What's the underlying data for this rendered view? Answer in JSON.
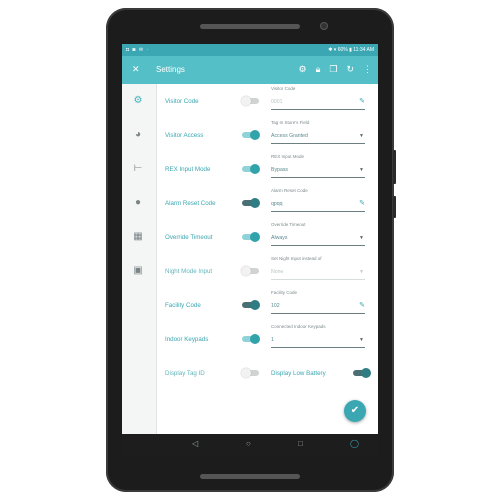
{
  "status_bar": {
    "left_icons": "◘ ◙ ✉ ·",
    "right_text": "✱ ▾ 60% ▮ 11:34 AM"
  },
  "app_bar": {
    "close_icon": "close-icon",
    "title": "Settings",
    "actions": [
      "gear-icon",
      "lock-icon",
      "copy-icon",
      "refresh-icon",
      "more-vert-icon"
    ]
  },
  "rail": [
    "gear-icon",
    "palette-icon",
    "tree-icon",
    "person-icon",
    "calendar-icon",
    "badge-icon"
  ],
  "settings": [
    {
      "label": "Visitor Code",
      "toggle": "off",
      "field_label": "Visitor Code",
      "field_value": "0001",
      "field_value_dim": true,
      "field_kind": "edit"
    },
    {
      "label": "Visitor Access",
      "toggle": "on",
      "field_label": "Tag In Store's Field",
      "field_value": "Access Granted",
      "field_kind": "dropdown"
    },
    {
      "label": "REX Input Mode",
      "toggle": "on",
      "field_label": "REX Input Mode",
      "field_value": "Bypass",
      "field_kind": "dropdown"
    },
    {
      "label": "Alarm Reset Code",
      "toggle": "dark",
      "field_label": "Alarm Reset Code",
      "field_value": "qpqq",
      "field_kind": "edit"
    },
    {
      "label": "Override Timeout",
      "toggle": "on",
      "field_label": "Override Timeout",
      "field_value": "Always",
      "field_kind": "dropdown"
    },
    {
      "label": "Night Mode Input",
      "toggle": "off",
      "field_label": "Set Night Input instead of",
      "field_value": "None",
      "field_value_dim": true,
      "field_kind": "dropdown_dim"
    },
    {
      "label": "Facility Code",
      "toggle": "dark",
      "field_label": "Facility Code",
      "field_value": "102",
      "field_kind": "edit"
    },
    {
      "label": "Indoor Keypads",
      "toggle": "on",
      "field_label": "Connected Indoor Keypads",
      "field_value": "1",
      "field_kind": "dropdown"
    },
    {
      "label": "Display Tag ID",
      "toggle": "off",
      "inline_label": "Display Low Battery",
      "inline_toggle": "dark",
      "field_kind": "inline"
    }
  ],
  "fab_icon": "check-icon",
  "nav_bar": [
    "back-icon",
    "home-icon",
    "recents-icon",
    "assistant-icon"
  ]
}
